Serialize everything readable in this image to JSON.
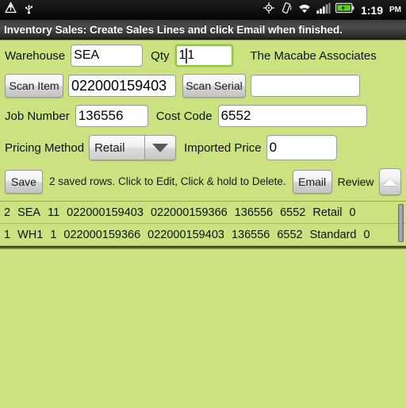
{
  "status_bar": {
    "left_icons": [
      "alert-triangle-icon",
      "usb-icon"
    ],
    "right_icons": [
      "gps-crosshair-icon",
      "vibrate-icon",
      "wifi-icon",
      "signal-bars-icon",
      "battery-icon"
    ],
    "time": "1:19",
    "ampm": "PM"
  },
  "title_bar": {
    "title": "Inventory Sales: Create Sales Lines and click Email when finished."
  },
  "form": {
    "warehouse_label": "Warehouse",
    "warehouse_value": "SEA",
    "qty_label": "Qty",
    "qty_value_before_caret": "1",
    "qty_value_after_caret": "1",
    "company_name": "The Macabe Associates",
    "scan_item_button": "Scan Item",
    "item_value": "022000159403",
    "scan_serial_button": "Scan Serial",
    "serial_value": "",
    "job_number_label": "Job Number",
    "job_number_value": "136556",
    "cost_code_label": "Cost Code",
    "cost_code_value": "6552",
    "pricing_method_label": "Pricing Method",
    "pricing_method_value": "Retail",
    "imported_price_label": "Imported Price",
    "imported_price_value": "0"
  },
  "actions": {
    "save_button": "Save",
    "status_text": "2 saved rows. Click to Edit, Click & hold to Delete.",
    "email_button": "Email",
    "review_label": "Review",
    "collapse_icon": "triangle-up-icon"
  },
  "saved_rows": [
    {
      "id": "2",
      "warehouse": "SEA",
      "qty": "11",
      "item": "022000159403",
      "serial": "022000159366",
      "job": "136556",
      "cost_code": "6552",
      "pricing": "Retail",
      "price": "0"
    },
    {
      "id": "1",
      "warehouse": "WH1",
      "qty": "1",
      "item": "022000159366",
      "serial": "022000159403",
      "job": "136556",
      "cost_code": "6552",
      "pricing": "Standard",
      "price": "0"
    }
  ],
  "colors": {
    "background_green": "#cce280",
    "focus_green": "#8cc63e",
    "titlebar_dark": "#404040"
  }
}
